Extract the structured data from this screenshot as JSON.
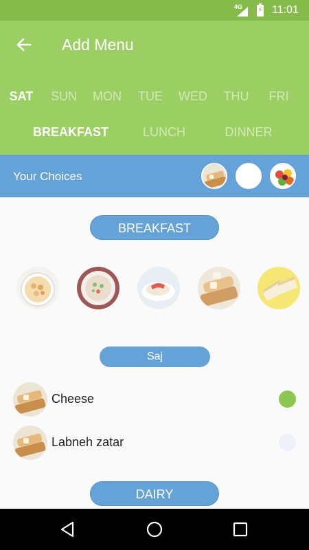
{
  "status_bar": {
    "network": "4G",
    "time": "11:01"
  },
  "app_bar": {
    "title": "Add Menu",
    "back_icon": "arrow-left-icon"
  },
  "days": [
    {
      "label": "SAT",
      "active": true
    },
    {
      "label": "SUN",
      "active": false
    },
    {
      "label": "MON",
      "active": false
    },
    {
      "label": "TUE",
      "active": false
    },
    {
      "label": "WED",
      "active": false
    },
    {
      "label": "THU",
      "active": false
    },
    {
      "label": "FRI",
      "active": false
    }
  ],
  "meals": [
    {
      "label": "BREAKFAST",
      "active": true
    },
    {
      "label": "LUNCH",
      "active": false
    },
    {
      "label": "DINNER",
      "active": false
    }
  ],
  "choices": {
    "label": "Your Choices"
  },
  "sections": {
    "breakfast": "BREAKFAST",
    "saj": "Saj",
    "dairy": "DAIRY"
  },
  "items": [
    {
      "name": "Cheese",
      "selected": true
    },
    {
      "name": "Labneh zatar",
      "selected": false
    }
  ],
  "colors": {
    "status_bar": "#86bb4c",
    "app_bar": "#9ccf63",
    "accent_blue": "#65a2d8",
    "selected_dot": "#8cc653",
    "unselected_dot": "#eef1fa"
  }
}
